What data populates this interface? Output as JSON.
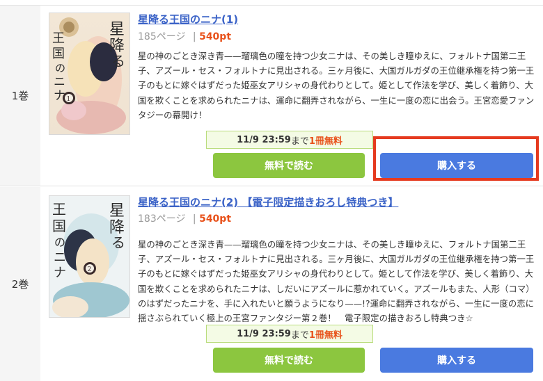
{
  "volumes": [
    {
      "label": "1巻",
      "title": "星降る王国のニナ(1)",
      "pages": "185ページ",
      "separator": "|",
      "price": "540pt",
      "description": "星の神のごとき深き青——瑠璃色の瞳を持つ少女ニナは、その美しき瞳ゆえに、フォルトナ国第二王子、アズール・セス・フォルトナに見出される。三ヶ月後に、大国ガルガダの王位継承権を持つ第一王子のもとに嫁ぐはずだった姫巫女アリシャの身代わりとして。姫として作法を学び、美しく着飾り、大国を欺くことを求められたニナは、運命に翻弄されながら、一生に一度の恋に出会う。王宮恋愛ファンタジーの幕開け！",
      "campaign": {
        "date": "11/9 23:59",
        "until": "まで",
        "free": "1冊無料"
      },
      "read_button": "無料で読む",
      "buy_button": "購入する",
      "cover": {
        "title_chars": "星降る王国のニナ",
        "volume_number": "1"
      }
    },
    {
      "label": "2巻",
      "title": "星降る王国のニナ(2) 【電子限定描きおろし特典つき】",
      "pages": "183ページ",
      "separator": "|",
      "price": "540pt",
      "description": "星の神のごとき深き青——瑠璃色の瞳を持つ少女ニナは、その美しき瞳ゆえに、フォルトナ国第二王子、アズール・セス・フォルトナに見出される。三ヶ月後に、大国ガルガダの王位継承権を持つ第一王子のもとに嫁ぐはずだった姫巫女アリシャの身代わりとして。姫として作法を学び、美しく着飾り、大国を欺くことを求められたニナは、しだいにアズールに惹かれていく。アズールもまた、人形（コマ）のはずだったニナを、手に入れたいと願うようになり——!?運命に翻弄されながら、一生に一度の恋に揺さぶられていく極上の王宮ファンタジー第２巻！　電子限定の描きおろし特典つき☆",
      "campaign": {
        "date": "11/9 23:59",
        "until": "まで",
        "free": "1冊無料"
      },
      "read_button": "無料で読む",
      "buy_button": "購入する",
      "cover": {
        "title_chars": "星降る王国のニナ",
        "volume_number": "2"
      }
    }
  ],
  "colors": {
    "link": "#3a62c7",
    "price": "#e8511a",
    "read_button": "#8cc63f",
    "buy_button": "#4a7ae0",
    "highlight": "#e53a1f",
    "campaign_bg": "#f4fbe5"
  }
}
